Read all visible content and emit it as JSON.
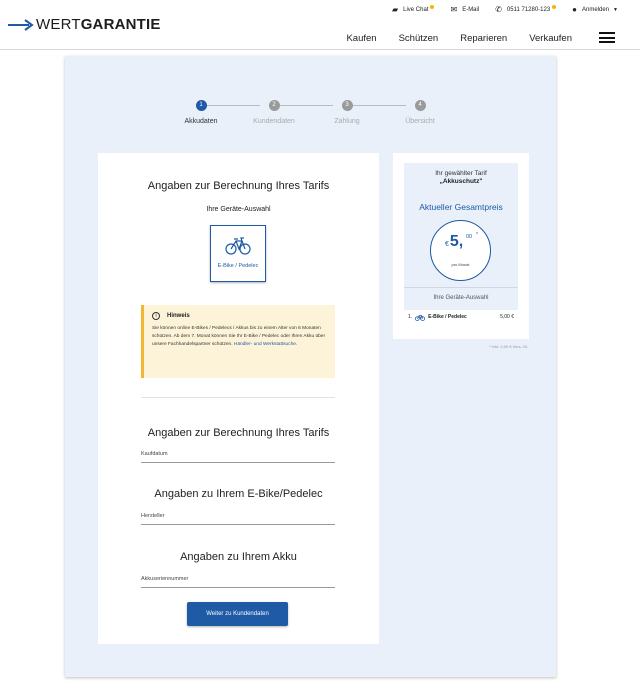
{
  "header": {
    "logo_light": "WERT",
    "logo_bold": "GARANTIE",
    "topbar": [
      {
        "icon": "chat-icon",
        "label": "Live Chat",
        "dot": true
      },
      {
        "icon": "mail-icon",
        "label": "E-Mail",
        "dot": false
      },
      {
        "icon": "phone-icon",
        "label": "0511 71280-123",
        "dot": true
      },
      {
        "icon": "user-icon",
        "label": "Anmelden",
        "dot": false
      }
    ],
    "nav": [
      "Kaufen",
      "Schützen",
      "Reparieren",
      "Verkaufen"
    ]
  },
  "stepper": {
    "steps": [
      {
        "num": "1",
        "label": "Akkudaten",
        "active": true
      },
      {
        "num": "2",
        "label": "Kundendaten",
        "active": false
      },
      {
        "num": "3",
        "label": "Zahlung",
        "active": false
      },
      {
        "num": "4",
        "label": "Übersicht",
        "active": false
      }
    ]
  },
  "form": {
    "title": "Angaben zur Berechnung Ihres Tarifs",
    "device_selection_label": "Ihre Geräte-Auswahl",
    "device_label": "E-Bike / Pedelec",
    "notice": {
      "title": "Hinweis",
      "text": "Sie können online E-Bikes / Pedelecs / Akkus bis zu einem Alter von 6 Monaten schützen. Ab dem 7. Monat können Sie Ihr E-Bike / Pedelec oder Ihren Akku über unsere Fachhandelspartner schützen. ",
      "link": "Händler- und Werkstattsuche",
      "tail": "."
    },
    "section1_title": "Angaben zur Berechnung Ihres Tarifs",
    "field_kaufdatum": "Kaufdatum",
    "section2_title": "Angaben zu Ihrem E-Bike/Pedelec",
    "field_hersteller": "Hersteller",
    "section3_title": "Angaben zu Ihrem Akku",
    "field_akku": "Akkuseriennummer",
    "next_button": "Weiter zu Kundendaten"
  },
  "tarif": {
    "chosen_label": "Ihr gewählter Tarif",
    "chosen_name": "„Akkuschutz\"",
    "price_title": "Aktueller Gesamtpreis",
    "currency": "€",
    "price_main": "5,",
    "price_cents": "00",
    "price_star": "*",
    "price_sub": "pro Monat",
    "selection_label": "Ihre Geräte-Auswahl",
    "item_num": "1.",
    "item_name": "E-Bike / Pedelec",
    "item_price": "5,00 €",
    "vat_note": "* inkl. 0,00 € Vers.-St."
  },
  "colors": {
    "primary": "#1e5aa5",
    "stage_bg": "#e9f0fa",
    "notice_bg": "#fdf3d8",
    "notice_accent": "#f2b632",
    "dot": "#f7b500"
  }
}
